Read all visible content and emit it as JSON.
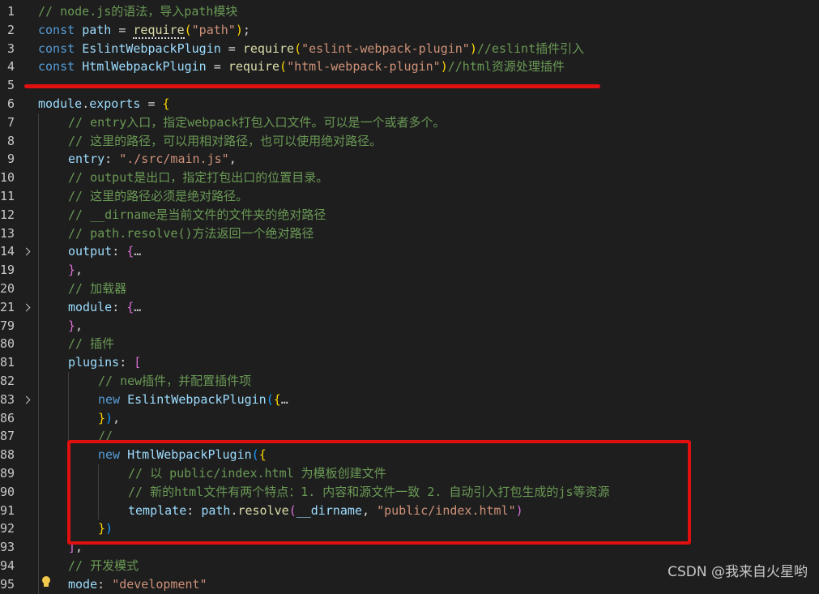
{
  "editor": {
    "lines": [
      {
        "num": "1",
        "fold": false,
        "indent": 0,
        "tokens": [
          {
            "t": "// node.js的语法，导入path模块",
            "c": "com"
          }
        ]
      },
      {
        "num": "2",
        "fold": false,
        "indent": 0,
        "tokens": [
          {
            "t": "const ",
            "c": "kw"
          },
          {
            "t": "path",
            "c": "var"
          },
          {
            "t": " = ",
            "c": "punc"
          },
          {
            "t": "require",
            "c": "fn",
            "u": true
          },
          {
            "t": "(",
            "c": "brace"
          },
          {
            "t": "\"path\"",
            "c": "str"
          },
          {
            "t": ")",
            "c": "brace"
          },
          {
            "t": ";",
            "c": "punc"
          }
        ]
      },
      {
        "num": "3",
        "fold": false,
        "indent": 0,
        "tokens": [
          {
            "t": "const ",
            "c": "kw"
          },
          {
            "t": "EslintWebpackPlugin",
            "c": "var"
          },
          {
            "t": " = ",
            "c": "punc"
          },
          {
            "t": "require",
            "c": "fn"
          },
          {
            "t": "(",
            "c": "brace"
          },
          {
            "t": "\"eslint-webpack-plugin\"",
            "c": "str"
          },
          {
            "t": ")",
            "c": "brace"
          },
          {
            "t": "//eslint插件引入",
            "c": "com"
          }
        ]
      },
      {
        "num": "4",
        "fold": false,
        "indent": 0,
        "tokens": [
          {
            "t": "const ",
            "c": "kw"
          },
          {
            "t": "HtmlWebpackPlugin",
            "c": "var"
          },
          {
            "t": " = ",
            "c": "punc"
          },
          {
            "t": "require",
            "c": "fn"
          },
          {
            "t": "(",
            "c": "brace"
          },
          {
            "t": "\"html-webpack-plugin\"",
            "c": "str"
          },
          {
            "t": ")",
            "c": "brace"
          },
          {
            "t": "//html资源处理插件",
            "c": "com"
          }
        ]
      },
      {
        "num": "5",
        "fold": false,
        "indent": 0,
        "tokens": []
      },
      {
        "num": "6",
        "fold": false,
        "indent": 0,
        "tokens": [
          {
            "t": "module",
            "c": "var"
          },
          {
            "t": ".",
            "c": "punc"
          },
          {
            "t": "exports",
            "c": "var"
          },
          {
            "t": " = ",
            "c": "punc"
          },
          {
            "t": "{",
            "c": "brace"
          }
        ]
      },
      {
        "num": "7",
        "fold": false,
        "indent": 1,
        "tokens": [
          {
            "t": "// entry入口，指定webpack打包入口文件。可以是一个或者多个。",
            "c": "com"
          }
        ]
      },
      {
        "num": "8",
        "fold": false,
        "indent": 1,
        "tokens": [
          {
            "t": "// 这里的路径，可以用相对路径，也可以使用绝对路径。",
            "c": "com"
          }
        ]
      },
      {
        "num": "9",
        "fold": false,
        "indent": 1,
        "tokens": [
          {
            "t": "entry",
            "c": "var"
          },
          {
            "t": ": ",
            "c": "punc"
          },
          {
            "t": "\"./src/main.js\"",
            "c": "str"
          },
          {
            "t": ",",
            "c": "punc"
          }
        ]
      },
      {
        "num": "10",
        "fold": false,
        "indent": 1,
        "tokens": [
          {
            "t": "// output是出口，指定打包出口的位置目录。",
            "c": "com"
          }
        ]
      },
      {
        "num": "11",
        "fold": false,
        "indent": 1,
        "tokens": [
          {
            "t": "// 这里的路径必须是绝对路径。",
            "c": "com"
          }
        ]
      },
      {
        "num": "12",
        "fold": false,
        "indent": 1,
        "tokens": [
          {
            "t": "// __dirname是当前文件的文件夹的绝对路径",
            "c": "com"
          }
        ]
      },
      {
        "num": "13",
        "fold": false,
        "indent": 1,
        "tokens": [
          {
            "t": "// path.resolve()方法返回一个绝对路径",
            "c": "com"
          }
        ]
      },
      {
        "num": "14",
        "fold": true,
        "indent": 1,
        "tokens": [
          {
            "t": "output",
            "c": "var"
          },
          {
            "t": ": ",
            "c": "punc"
          },
          {
            "t": "{",
            "c": "brace2"
          },
          {
            "t": "…",
            "c": "punc"
          }
        ]
      },
      {
        "num": "19",
        "fold": false,
        "indent": 1,
        "tokens": [
          {
            "t": "}",
            "c": "brace2"
          },
          {
            "t": ",",
            "c": "punc"
          }
        ]
      },
      {
        "num": "20",
        "fold": false,
        "indent": 1,
        "tokens": [
          {
            "t": "// 加载器",
            "c": "com"
          }
        ]
      },
      {
        "num": "21",
        "fold": true,
        "indent": 1,
        "tokens": [
          {
            "t": "module",
            "c": "var"
          },
          {
            "t": ": ",
            "c": "punc"
          },
          {
            "t": "{",
            "c": "brace2"
          },
          {
            "t": "…",
            "c": "punc"
          }
        ]
      },
      {
        "num": "79",
        "fold": false,
        "indent": 1,
        "tokens": [
          {
            "t": "}",
            "c": "brace2"
          },
          {
            "t": ",",
            "c": "punc"
          }
        ]
      },
      {
        "num": "80",
        "fold": false,
        "indent": 1,
        "tokens": [
          {
            "t": "// 插件",
            "c": "com"
          }
        ]
      },
      {
        "num": "81",
        "fold": false,
        "indent": 1,
        "tokens": [
          {
            "t": "plugins",
            "c": "var"
          },
          {
            "t": ": ",
            "c": "punc"
          },
          {
            "t": "[",
            "c": "brace2"
          }
        ]
      },
      {
        "num": "82",
        "fold": false,
        "indent": 2,
        "tokens": [
          {
            "t": "// new插件，并配置插件项",
            "c": "com"
          }
        ]
      },
      {
        "num": "83",
        "fold": true,
        "indent": 2,
        "tokens": [
          {
            "t": "new ",
            "c": "kw"
          },
          {
            "t": "EslintWebpackPlugin",
            "c": "var"
          },
          {
            "t": "(",
            "c": "brace3"
          },
          {
            "t": "{",
            "c": "brace"
          },
          {
            "t": "…",
            "c": "punc"
          }
        ]
      },
      {
        "num": "86",
        "fold": false,
        "indent": 2,
        "tokens": [
          {
            "t": "}",
            "c": "brace"
          },
          {
            "t": ")",
            "c": "brace3"
          },
          {
            "t": ",",
            "c": "punc"
          }
        ]
      },
      {
        "num": "87",
        "fold": false,
        "indent": 2,
        "tokens": [
          {
            "t": "//",
            "c": "com"
          }
        ]
      },
      {
        "num": "88",
        "fold": false,
        "indent": 2,
        "tokens": [
          {
            "t": "new ",
            "c": "kw"
          },
          {
            "t": "HtmlWebpackPlugin",
            "c": "var"
          },
          {
            "t": "(",
            "c": "brace3"
          },
          {
            "t": "{",
            "c": "brace"
          }
        ]
      },
      {
        "num": "89",
        "fold": false,
        "indent": 3,
        "tokens": [
          {
            "t": "// 以 public/index.html 为模板创建文件",
            "c": "com"
          }
        ]
      },
      {
        "num": "90",
        "fold": false,
        "indent": 3,
        "tokens": [
          {
            "t": "// 新的html文件有两个特点：1. 内容和源文件一致 2. 自动引入打包生成的js等资源",
            "c": "com"
          }
        ]
      },
      {
        "num": "91",
        "fold": false,
        "indent": 3,
        "tokens": [
          {
            "t": "template",
            "c": "var"
          },
          {
            "t": ": ",
            "c": "punc"
          },
          {
            "t": "path",
            "c": "var"
          },
          {
            "t": ".",
            "c": "punc"
          },
          {
            "t": "resolve",
            "c": "fn"
          },
          {
            "t": "(",
            "c": "brace2"
          },
          {
            "t": "__dirname",
            "c": "var"
          },
          {
            "t": ", ",
            "c": "punc"
          },
          {
            "t": "\"public/index.html\"",
            "c": "str"
          },
          {
            "t": ")",
            "c": "brace2"
          }
        ]
      },
      {
        "num": "92",
        "fold": false,
        "indent": 2,
        "tokens": [
          {
            "t": "}",
            "c": "brace"
          },
          {
            "t": ")",
            "c": "brace3"
          }
        ]
      },
      {
        "num": "93",
        "fold": false,
        "indent": 1,
        "tokens": [
          {
            "t": "]",
            "c": "brace2"
          },
          {
            "t": ",",
            "c": "punc"
          }
        ]
      },
      {
        "num": "94",
        "fold": false,
        "indent": 1,
        "tokens": [
          {
            "t": "// 开发模式",
            "c": "com"
          }
        ]
      },
      {
        "num": "95",
        "fold": false,
        "indent": 1,
        "tokens": [
          {
            "t": "mode",
            "c": "var"
          },
          {
            "t": ": ",
            "c": "punc"
          },
          {
            "t": "\"development\"",
            "c": "str"
          }
        ]
      }
    ]
  },
  "watermark": "CSDN @我来自火星哟",
  "colors": {
    "background": "#1e1e1e",
    "keyword": "#569cd6",
    "variable": "#9cdcfe",
    "function": "#dcdcaa",
    "string": "#ce9178",
    "comment": "#6a9955",
    "punctuation": "#d4d4d4",
    "highlight": "#e01010"
  },
  "icons": [
    "chevron-right-icon",
    "lightbulb-icon"
  ]
}
